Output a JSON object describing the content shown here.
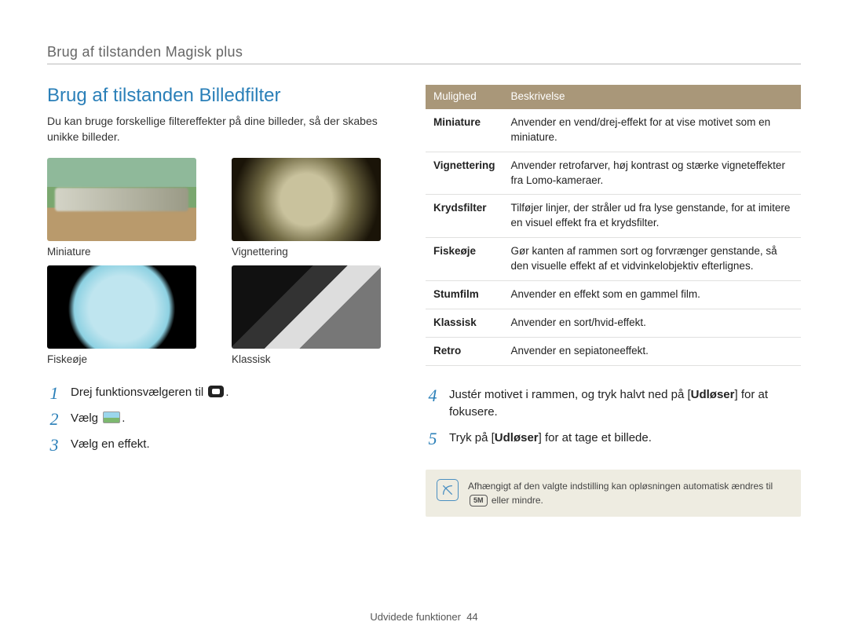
{
  "breadcrumb": "Brug af tilstanden Magisk plus",
  "title": "Brug af tilstanden Billedfilter",
  "intro": "Du kan bruge forskellige filtereffekter på dine billeder, så der skabes unikke billeder.",
  "thumbs": [
    {
      "label": "Miniature"
    },
    {
      "label": "Vignettering"
    },
    {
      "label": "Fiskeøje"
    },
    {
      "label": "Klassisk"
    }
  ],
  "steps_left": [
    {
      "num": "1",
      "text_a": "Drej funktionsvælgeren til ",
      "text_b": "."
    },
    {
      "num": "2",
      "text_a": "Vælg ",
      "text_b": "."
    },
    {
      "num": "3",
      "text_a": "Vælg en effekt."
    }
  ],
  "steps_right": [
    {
      "num": "4",
      "text_a": "Justér motivet i rammen, og tryk halvt ned på [",
      "bold": "Udløser",
      "text_b": "] for at fokusere."
    },
    {
      "num": "5",
      "text_a": "Tryk på [",
      "bold": "Udløser",
      "text_b": "] for at tage et billede."
    }
  ],
  "table": {
    "head": {
      "c1": "Mulighed",
      "c2": "Beskrivelse"
    },
    "rows": [
      {
        "name": "Miniature",
        "desc": "Anvender en vend/drej-effekt for at vise motivet som en miniature."
      },
      {
        "name": "Vignettering",
        "desc": "Anvender retrofarver, høj kontrast og stærke vigneteffekter fra Lomo-kameraer."
      },
      {
        "name": "Krydsfilter",
        "desc": "Tilføjer linjer, der stråler ud fra lyse genstande, for at imitere en visuel effekt fra et krydsfilter."
      },
      {
        "name": "Fiskeøje",
        "desc": "Gør kanten af rammen sort og forvrænger genstande, så den visuelle effekt af et vidvinkelobjektiv efterlignes."
      },
      {
        "name": "Stumfilm",
        "desc": "Anvender en effekt som en gammel film."
      },
      {
        "name": "Klassisk",
        "desc": "Anvender en sort/hvid-effekt."
      },
      {
        "name": "Retro",
        "desc": "Anvender en sepiatoneeffekt."
      }
    ]
  },
  "note": {
    "text_a": "Afhængigt af den valgte indstilling kan opløsningen automatisk ændres til ",
    "badge": "5M",
    "text_b": " eller mindre."
  },
  "footer": {
    "label": "Udvidede funktioner",
    "page": "44"
  }
}
